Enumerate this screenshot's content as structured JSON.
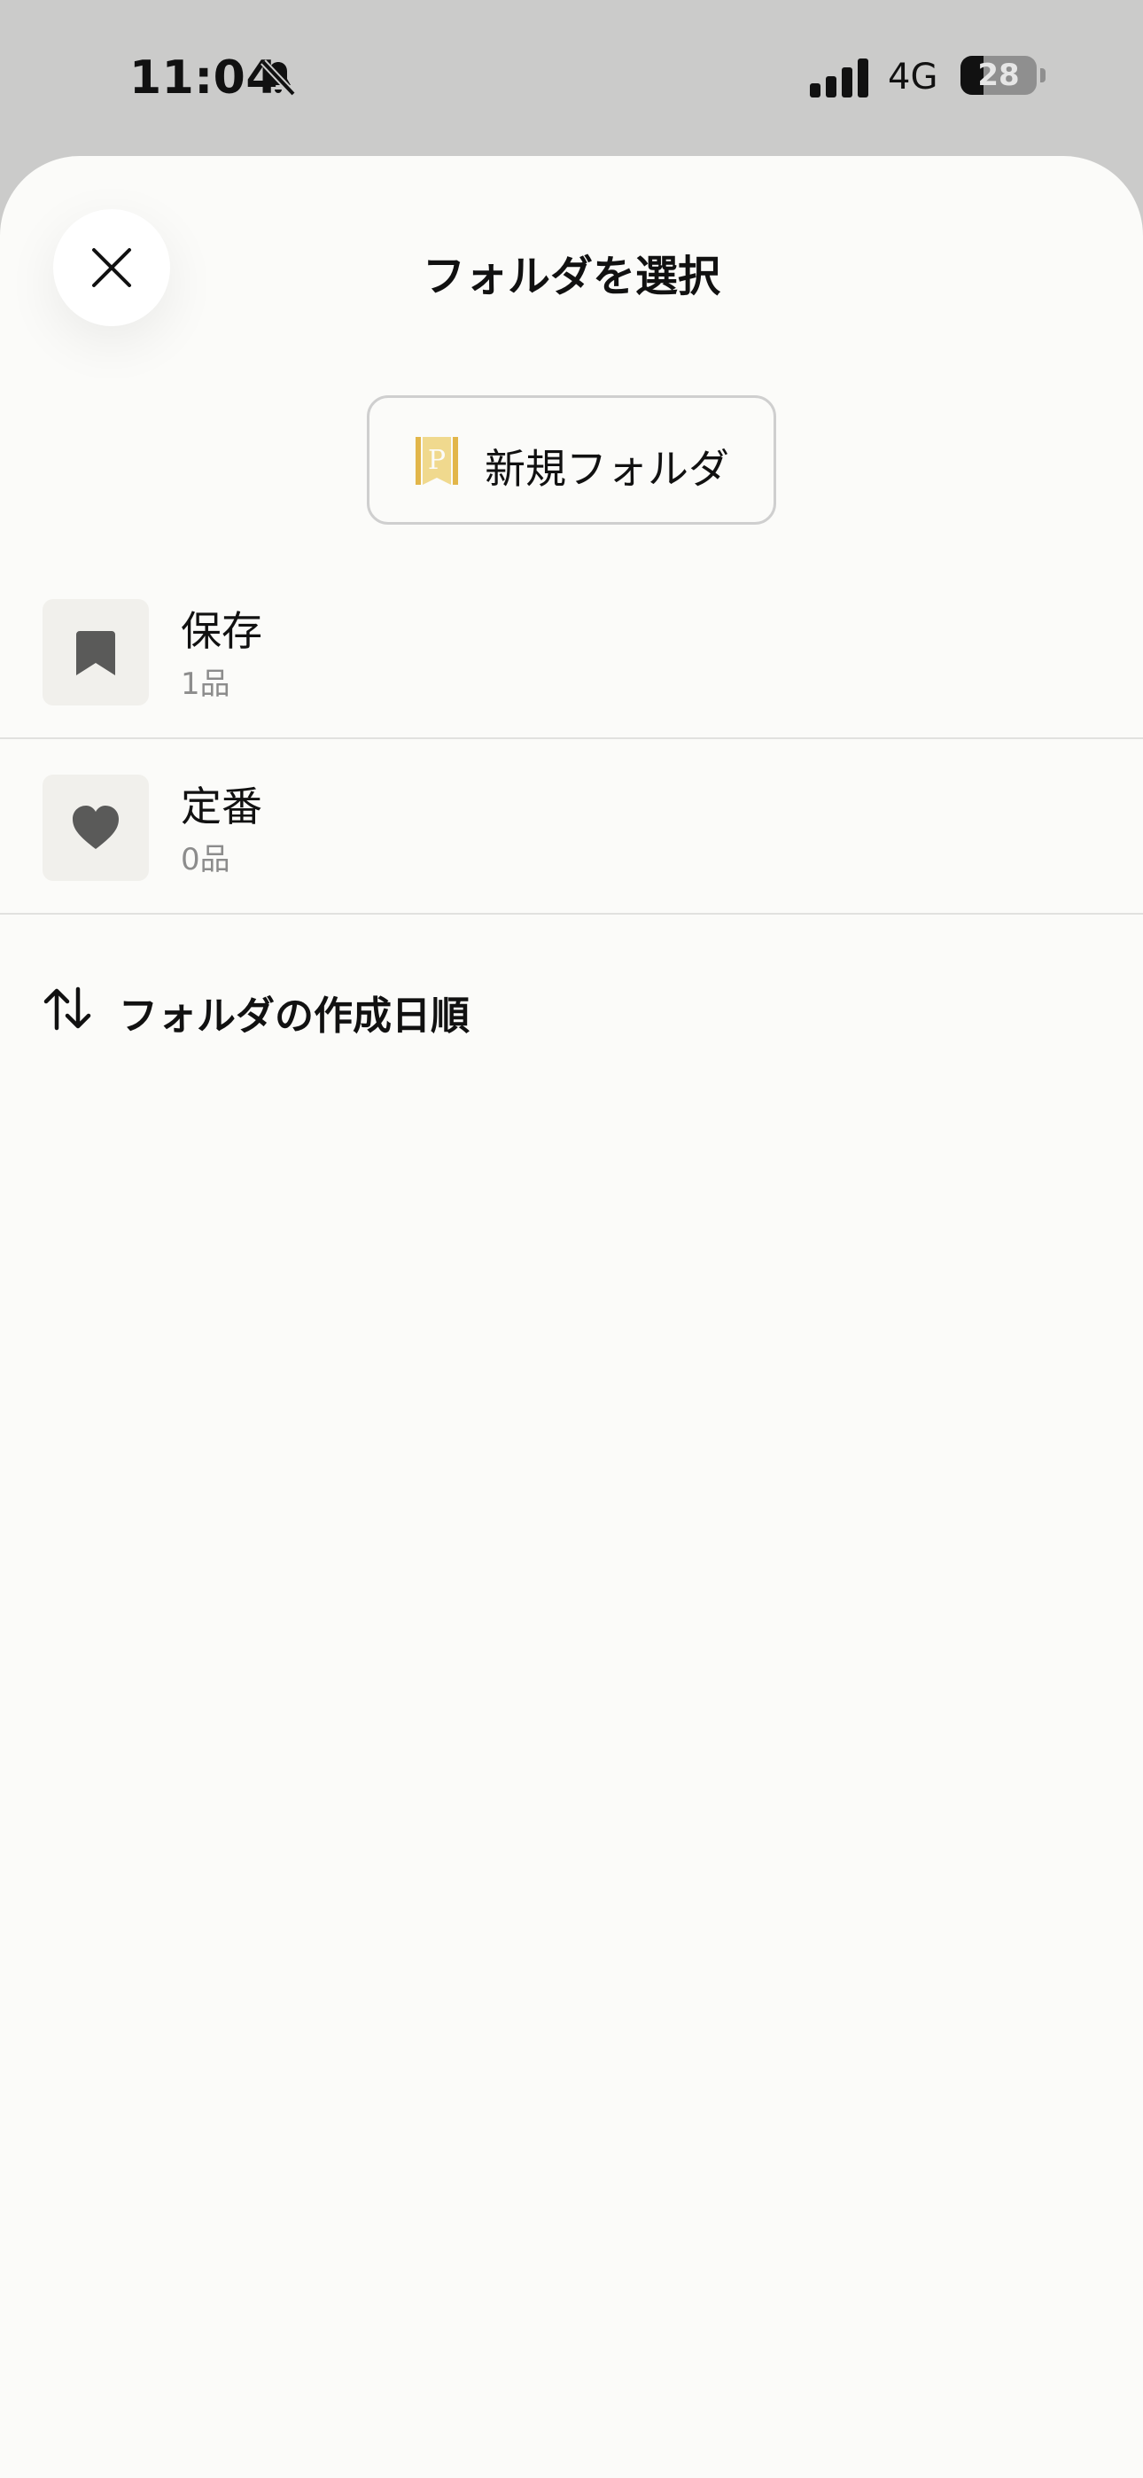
{
  "status_bar": {
    "time": "11:04",
    "network": "4G",
    "battery": "28"
  },
  "sheet": {
    "title": "フォルダを選択",
    "new_folder_label": "新規フォルダ",
    "folders": [
      {
        "name": "保存",
        "count": "1品",
        "icon": "bookmark-icon"
      },
      {
        "name": "定番",
        "count": "0品",
        "icon": "heart-icon"
      }
    ],
    "sort_label": "フォルダの作成日順"
  },
  "colors": {
    "accent": "#e2b64a",
    "icon": "#5a5a59",
    "background": "#fbfbf9"
  }
}
